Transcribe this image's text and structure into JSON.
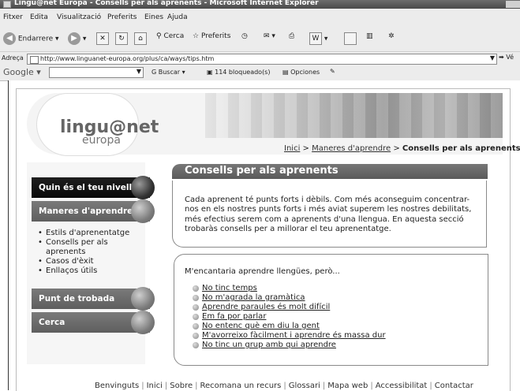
{
  "window": {
    "title": "Lingu@net Europa - Consells per als aprenents - Microsoft Internet Explorer"
  },
  "menu": [
    "Fitxer",
    "Edita",
    "Visualització",
    "Preferits",
    "Eines",
    "Ajuda"
  ],
  "toolbar": {
    "back": "Endarrere",
    "search": "Cerca",
    "favorites": "Preferits"
  },
  "address": {
    "label": "Adreça",
    "url": "http://www.linguanet-europa.org/plus/ca/ways/tips.htm",
    "go": "Vé"
  },
  "google": {
    "label": "Google",
    "search_btn": "Buscar",
    "blocked": "114 bloqueado(s)",
    "options": "Opciones"
  },
  "logo": {
    "main": "lingu@net",
    "sub": "europa"
  },
  "breadcrumb": {
    "home": "Inici",
    "sep": ">",
    "ways": "Maneres d'aprendre",
    "current": "Consells per als aprenents"
  },
  "nav": {
    "level": "Quin és el teu nivell?",
    "ways": "Maneres d'aprendre",
    "subitems": [
      "Estils d'aprenentatge",
      "Consells per als aprenents",
      "Casos d'èxit",
      "Enllaços útils"
    ],
    "meeting": "Punt de trobada",
    "search": "Cerca"
  },
  "content": {
    "title": "Consells per als aprenents",
    "intro": "Cada aprenent té punts forts i dèbils. Com més aconseguim concentrar-nos en els nostres punts forts i més aviat superem les nostres debilitats, més efectius serem com a aprenents d'una llengua. En aquesta secció trobaràs consells per a millorar el teu aprenentatge.",
    "lead": "M'encantaria aprendre llengües, però...",
    "links": [
      "No tinc temps",
      "No m'agrada la gramàtica",
      "Aprendre paraules és molt difícil",
      "Em fa por parlar",
      "No entenc què em diu la gent",
      "M'avorreixo fàcilment i aprendre és massa dur",
      "No tinc un grup amb qui aprendre"
    ]
  },
  "footer": [
    "Benvinguts",
    "Inici",
    "Sobre",
    "Recomana un recurs",
    "Glossari",
    "Mapa web",
    "Accessibilitat",
    "Contactar"
  ]
}
